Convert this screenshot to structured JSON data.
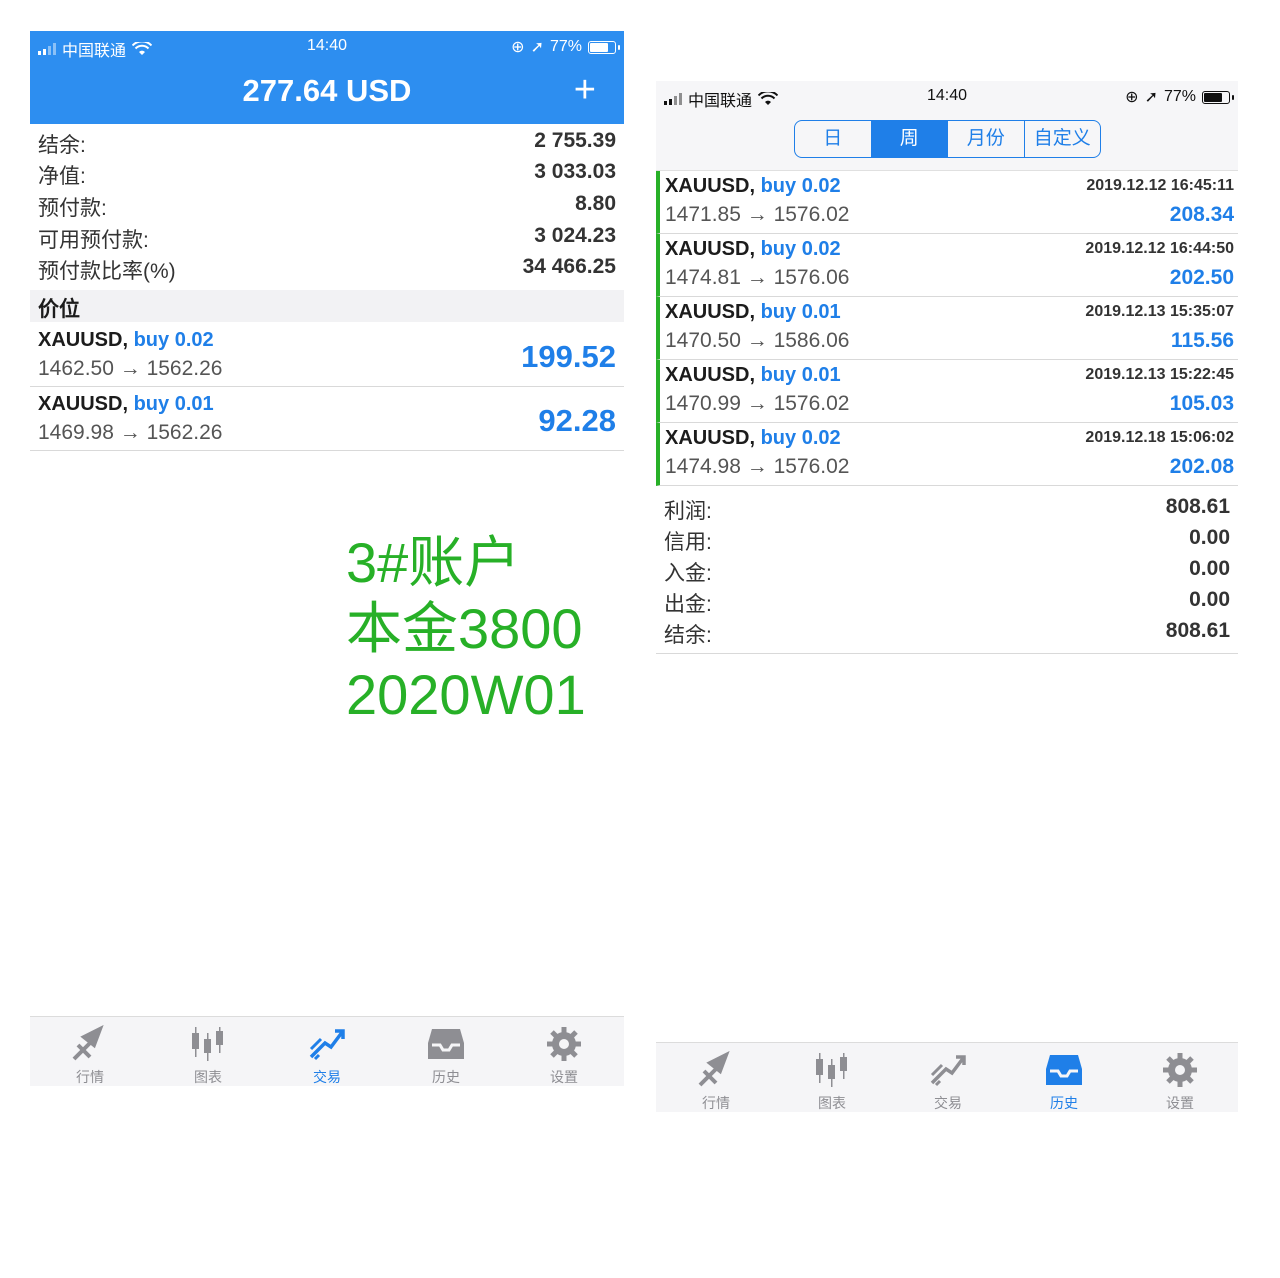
{
  "left": {
    "status": {
      "carrier": "中国联通",
      "time": "14:40",
      "battery": "77%"
    },
    "header_title": "277.64 USD",
    "plus": "+",
    "account": [
      {
        "label": "结余:",
        "value": "2 755.39"
      },
      {
        "label": "净值:",
        "value": "3 033.03"
      },
      {
        "label": "预付款:",
        "value": "8.80"
      },
      {
        "label": "可用预付款:",
        "value": "3 024.23"
      },
      {
        "label": "预付款比率(%)",
        "value": "34 466.25"
      }
    ],
    "section_title": "价位",
    "positions": [
      {
        "symbol": "XAUUSD,",
        "side": "buy 0.02",
        "prices": "1462.50 → 1562.26",
        "profit": "199.52"
      },
      {
        "symbol": "XAUUSD,",
        "side": "buy 0.01",
        "prices": "1469.98 → 1562.26",
        "profit": "92.28"
      }
    ],
    "tabs": [
      "行情",
      "图表",
      "交易",
      "历史",
      "设置"
    ],
    "active_tab": "交易"
  },
  "overlay": {
    "line1": "3#账户",
    "line2": "本金3800",
    "line3": "2020W01"
  },
  "right": {
    "status": {
      "carrier": "中国联通",
      "time": "14:40",
      "battery": "77%"
    },
    "segments": [
      "日",
      "周",
      "月份",
      "自定义"
    ],
    "active_segment": "周",
    "deals": [
      {
        "symbol": "XAUUSD,",
        "side": "buy 0.02",
        "prices": "1471.85 → 1576.02",
        "time": "2019.12.12 16:45:11",
        "profit": "208.34"
      },
      {
        "symbol": "XAUUSD,",
        "side": "buy 0.02",
        "prices": "1474.81 → 1576.06",
        "time": "2019.12.12 16:44:50",
        "profit": "202.50"
      },
      {
        "symbol": "XAUUSD,",
        "side": "buy 0.01",
        "prices": "1470.50 → 1586.06",
        "time": "2019.12.13 15:35:07",
        "profit": "115.56"
      },
      {
        "symbol": "XAUUSD,",
        "side": "buy 0.01",
        "prices": "1470.99 → 1576.02",
        "time": "2019.12.13 15:22:45",
        "profit": "105.03"
      },
      {
        "symbol": "XAUUSD,",
        "side": "buy 0.02",
        "prices": "1474.98 → 1576.02",
        "time": "2019.12.18 15:06:02",
        "profit": "202.08"
      }
    ],
    "summary": [
      {
        "label": "利润:",
        "value": "808.61"
      },
      {
        "label": "信用:",
        "value": "0.00"
      },
      {
        "label": "入金:",
        "value": "0.00"
      },
      {
        "label": "出金:",
        "value": "0.00"
      },
      {
        "label": "结余:",
        "value": "808.61"
      }
    ],
    "tabs": [
      "行情",
      "图表",
      "交易",
      "历史",
      "设置"
    ],
    "active_tab": "历史"
  },
  "colors": {
    "accent_blue": "#1f7fe8",
    "header_blue": "#2d8ef0",
    "profit_green_bar": "#27b027",
    "overlay_green": "#27b027"
  }
}
